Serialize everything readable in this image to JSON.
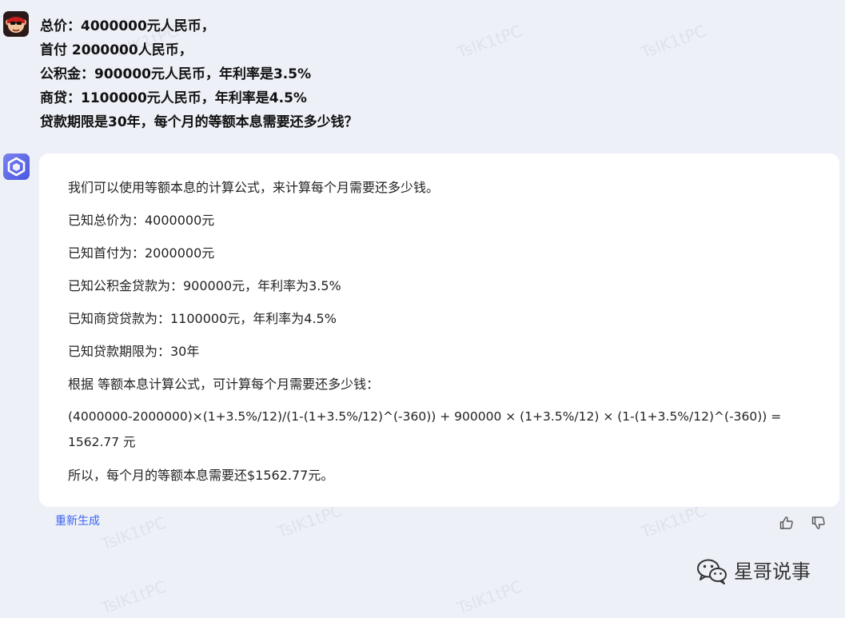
{
  "user": {
    "lines": [
      "总价：4000000元人民币，",
      "首付 2000000人民币，",
      "公积金：900000元人民币，年利率是3.5%",
      "商贷：1100000元人民币，年利率是4.5%",
      "贷款期限是30年，每个月的等额本息需要还多少钱？"
    ]
  },
  "bot": {
    "intro": "我们可以使用等额本息的计算公式，来计算每个月需要还多少钱。",
    "facts": [
      "已知总价为：4000000元",
      "已知首付为：2000000元",
      "已知公积金贷款为：900000元，年利率为3.5%",
      "已知商贷贷款为：1100000元，年利率为4.5%",
      "已知贷款期限为：30年"
    ],
    "method": "根据 等额本息计算公式，可计算每个月需要还多少钱：",
    "formula_line1": "(4000000-2000000)×(1+3.5%/12)/(1-(1+3.5%/12)^(-360)) + 900000 × (1+3.5%/12) × (1-(1+3.5%/12)^(-360)) =",
    "formula_line2": "1562.77 元",
    "conclusion": "所以，每个月的等额本息需要还$1562.77元。"
  },
  "actions": {
    "regenerate_label": "重新生成",
    "like_icon": "thumbs-up-icon",
    "dislike_icon": "thumbs-down-icon"
  },
  "brand": {
    "name": "星哥说事",
    "icon": "wechat-icon"
  },
  "watermark": {
    "text": "TslK1tPC"
  },
  "colors": {
    "background": "#eef0f8",
    "card": "#ffffff",
    "link": "#3a64f0",
    "bot_avatar": "#5b67e8"
  }
}
